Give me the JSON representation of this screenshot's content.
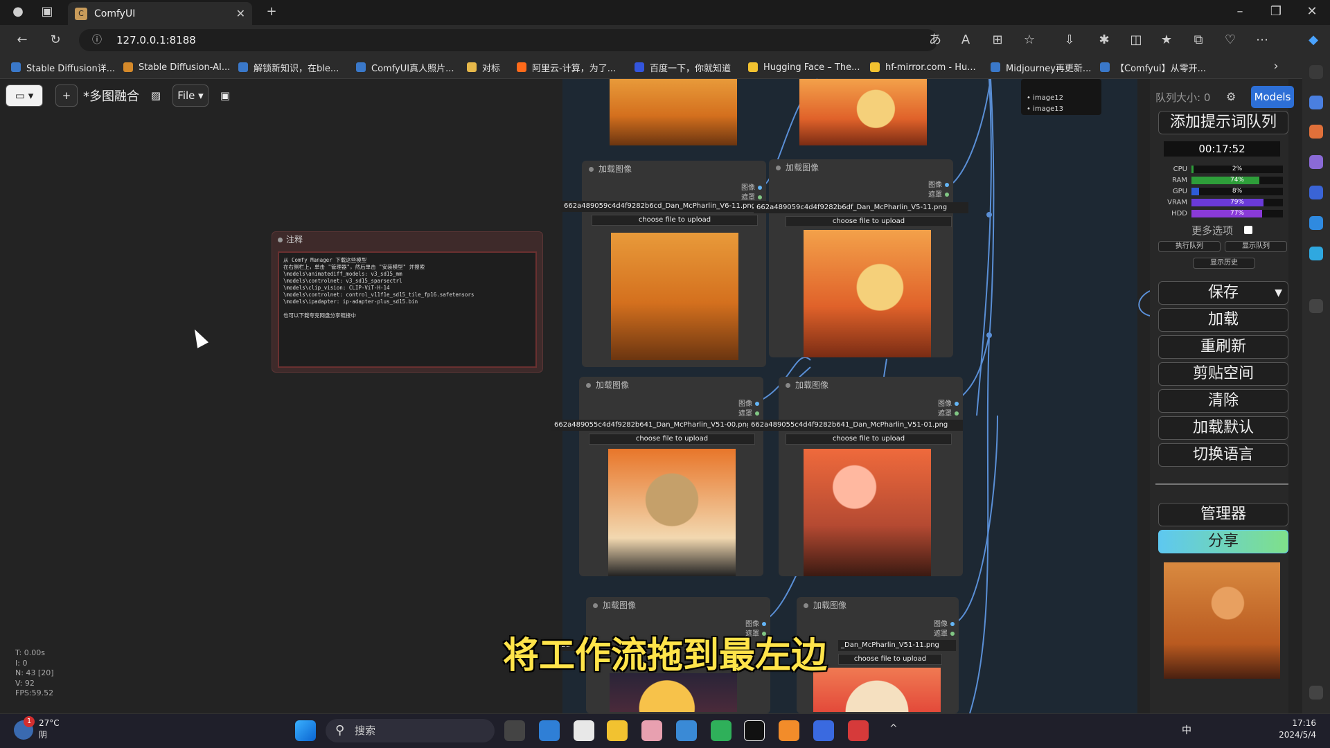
{
  "browser": {
    "tab_title": "ComfyUI",
    "url": "127.0.0.1:8188",
    "bookmarks": [
      "Stable Diffusion详...",
      "Stable Diffusion-AI...",
      "解锁新知识，在ble...",
      "ComfyUI真人照片...",
      "对标",
      "阿里云-计算，为了...",
      "百度一下，你就知道",
      "Hugging Face – The...",
      "hf-mirror.com - Hu...",
      "Midjourney再更新...",
      "【Comfyui】从零开..."
    ]
  },
  "comfy": {
    "workflow_name": "*多图融合",
    "file_menu": "File",
    "note_title": "注释",
    "note_text": "从 Comfy Manager 下载这些模型\n在右侧栏上，单击 \"管理器\"，然后单击 \"安装模型\" 并搜索\n\\models\\animatediff_models: v3_sd15_mm\n\\models\\controlnet: v3_sd15_sparsectrl\n\\models\\clip_vision: CLIP-ViT-H-14\n\\models\\controlnet: control_v11f1e_sd15_tile_fp16.safetensors\n\\models\\ipadapter: ip-adapter-plus_sd15.bin\n\n也可以下载夸克网盘分享链接中",
    "load_nodes": [
      {
        "title": "加载图像",
        "file": "662a489059c4d4f9282b6cd_Dan_McPharlin_V6-11.png"
      },
      {
        "title": "加载图像",
        "file": "662a489059c4d4f9282b6df_Dan_McPharlin_V5-11.png"
      },
      {
        "title": "加载图像",
        "file": "662a489055c4d4f9282b641_Dan_McPharlin_V51-00.png"
      },
      {
        "title": "加载图像",
        "file": "662a489055c4d4f9282b641_Dan_McPharlin_V51-01.png"
      },
      {
        "title": "加载图像",
        "file": "62a"
      },
      {
        "title": "加载图像",
        "file": "_Dan_McPharlin_V51-11.png"
      }
    ],
    "upload_label": "choose file to upload",
    "out_image": "图像",
    "out_mask": "遮罩",
    "list_items": [
      "image12",
      "image13"
    ],
    "stats": {
      "t": "T: 0.00s",
      "i": "I: 0",
      "n": "N: 43 [20]",
      "v": "V: 92",
      "fps": "FPS:59.52"
    }
  },
  "panel": {
    "queue_size": "队列大小: 0",
    "models_btn": "Models",
    "queue_prompt": "添加提示词队列",
    "timer": "00:17:52",
    "monitors": [
      {
        "label": "CPU",
        "value": "2%",
        "pct": 2,
        "color": "#2e9e3a"
      },
      {
        "label": "RAM",
        "value": "74%",
        "pct": 74,
        "color": "#2e9e3a"
      },
      {
        "label": "GPU",
        "value": "8%",
        "pct": 8,
        "color": "#2e5bd8"
      },
      {
        "label": "VRAM",
        "value": "79%",
        "pct": 79,
        "color": "#6a3ad8"
      },
      {
        "label": "HDD",
        "value": "77%",
        "pct": 77,
        "color": "#8a3ad8"
      }
    ],
    "more_options": "更多选项",
    "small_btns": [
      "执行队列",
      "显示队列",
      "显示历史"
    ],
    "buttons": [
      "保存",
      "加载",
      "重刷新",
      "剪贴空间",
      "清除",
      "加载默认",
      "切换语言"
    ],
    "manager": "管理器",
    "share": "分享"
  },
  "caption": "将工作流拖到最左边",
  "taskbar": {
    "search": "搜索",
    "temp": "27°C",
    "weather": "阴",
    "time": "17:16",
    "date": "2024/5/4",
    "badge": "1",
    "ime": "中"
  }
}
